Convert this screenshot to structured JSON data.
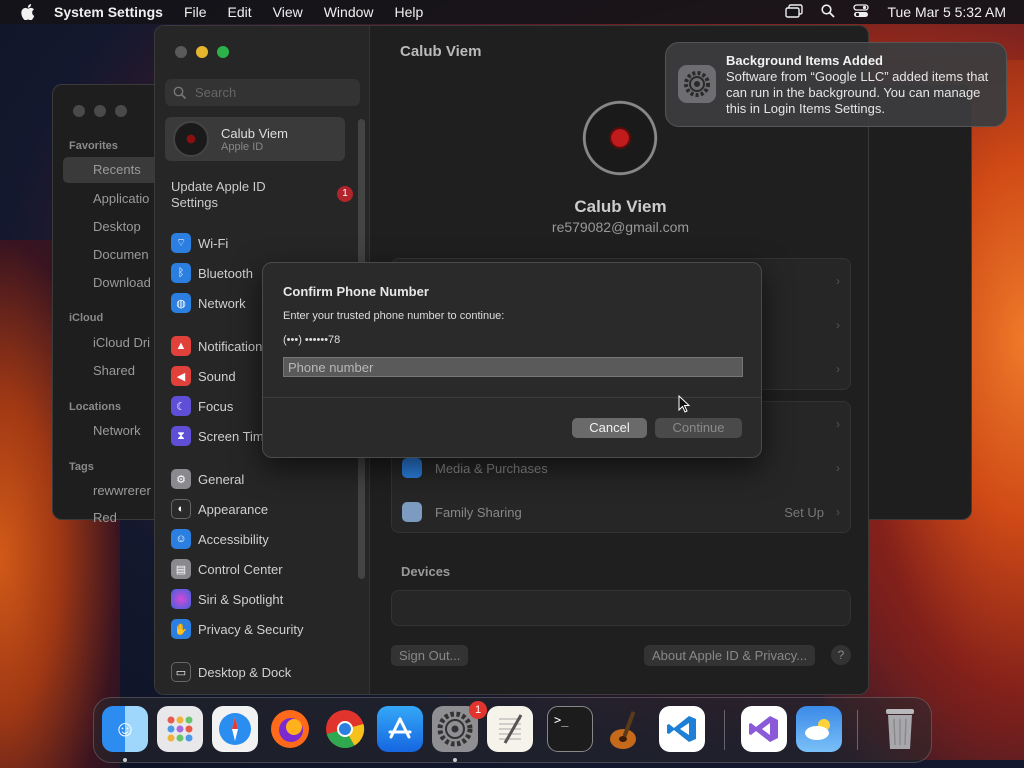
{
  "menubar": {
    "app_name": "System Settings",
    "menus": [
      "File",
      "Edit",
      "View",
      "Window",
      "Help"
    ],
    "clock": "Tue Mar 5  5:32 AM"
  },
  "finder": {
    "sections": {
      "favorites": "Favorites",
      "icloud": "iCloud",
      "locations": "Locations",
      "tags": "Tags"
    },
    "items": {
      "recents": "Recents",
      "applications": "Applicatio",
      "desktop": "Desktop",
      "documents": "Documen",
      "downloads": "Download",
      "icloud_drive": "iCloud Dri",
      "shared": "Shared",
      "network": "Network",
      "tag1": "rewwrerer",
      "tag2": "Red"
    }
  },
  "settings": {
    "search_placeholder": "Search",
    "account": {
      "name": "Calub Viem",
      "subtitle": "Apple ID"
    },
    "update": {
      "label": "Update Apple ID Settings",
      "badge": "1"
    },
    "nav": [
      {
        "label": "Wi-Fi",
        "color": "#2b7fe0"
      },
      {
        "label": "Bluetooth",
        "color": "#2b7fe0"
      },
      {
        "label": "Network",
        "color": "#2b7fe0"
      },
      {
        "label": "Notifications",
        "color": "#e0413a"
      },
      {
        "label": "Sound",
        "color": "#e0413a"
      },
      {
        "label": "Focus",
        "color": "#5e4fd6"
      },
      {
        "label": "Screen Time",
        "color": "#5e4fd6"
      },
      {
        "label": "General",
        "color": "#8a8a8e"
      },
      {
        "label": "Appearance",
        "color": "#2a2a2a"
      },
      {
        "label": "Accessibility",
        "color": "#2b7fe0"
      },
      {
        "label": "Control Center",
        "color": "#8a8a8e"
      },
      {
        "label": "Siri & Spotlight",
        "color": "#a83ad4"
      },
      {
        "label": "Privacy & Security",
        "color": "#2b7fe0"
      },
      {
        "label": "Desktop & Dock",
        "color": "#2a2a2a"
      }
    ],
    "main": {
      "title": "Calub Viem",
      "name": "Calub Viem",
      "email": "re579082@gmail.com",
      "media_purchases": "Media & Purchases",
      "family_sharing": "Family Sharing",
      "family_setup": "Set Up",
      "devices_title": "Devices",
      "sign_out": "Sign Out...",
      "about_privacy": "About Apple ID & Privacy...",
      "help": "?"
    }
  },
  "dialog": {
    "title": "Confirm Phone Number",
    "message": "Enter your trusted phone number to continue:",
    "phone_hint": "(•••) ••••••78",
    "input_placeholder": "Phone number",
    "input_value": "",
    "cancel": "Cancel",
    "continue": "Continue"
  },
  "notification": {
    "title": "Background Items Added",
    "body": "Software from “Google LLC” added items that can run in the background. You can manage this in Login Items Settings."
  },
  "dock": {
    "settings_badge": "1",
    "apps": [
      "finder-icon",
      "launchpad-icon",
      "safari-icon",
      "firefox-icon",
      "chrome-icon",
      "app-store-icon",
      "system-settings-icon",
      "textedit-icon",
      "terminal-icon",
      "garageband-icon",
      "vscode-icon",
      "visual-studio-icon",
      "weather-icon",
      "trash-icon"
    ]
  }
}
